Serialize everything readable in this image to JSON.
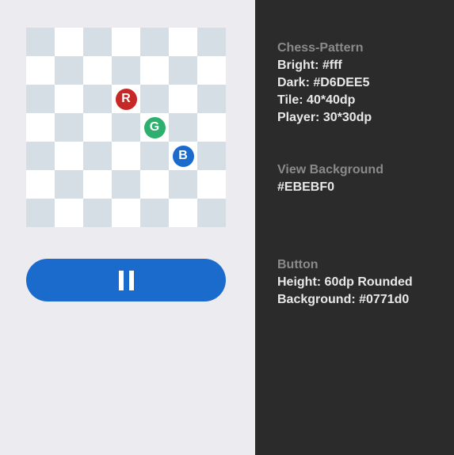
{
  "colors": {
    "view_background": "#EBEBF0",
    "panel_background": "#2b2b2b",
    "tile_bright": "#ffffff",
    "tile_dark": "#D6DEE5",
    "button_background": "#1a6bcc",
    "heading_text": "#8a8a8a",
    "value_text": "#e8e8e8"
  },
  "board": {
    "rows": 7,
    "cols": 7,
    "players": [
      {
        "label": "R",
        "row": 2,
        "col": 3,
        "color": "#c62828"
      },
      {
        "label": "G",
        "row": 3,
        "col": 4,
        "color": "#2eaf6e"
      },
      {
        "label": "B",
        "row": 4,
        "col": 5,
        "color": "#1a6bcc"
      }
    ]
  },
  "pause_button": {
    "icon": "pause-icon"
  },
  "info": [
    {
      "heading": "Chess-Pattern",
      "lines": [
        "Bright: #fff",
        "Dark: #D6DEE5",
        "Tile: 40*40dp",
        "Player: 30*30dp"
      ]
    },
    {
      "heading": "View Background",
      "lines": [
        "#EBEBF0"
      ]
    },
    {
      "heading": "Button",
      "lines": [
        "Height: 60dp Rounded",
        "Background: #0771d0"
      ]
    }
  ]
}
